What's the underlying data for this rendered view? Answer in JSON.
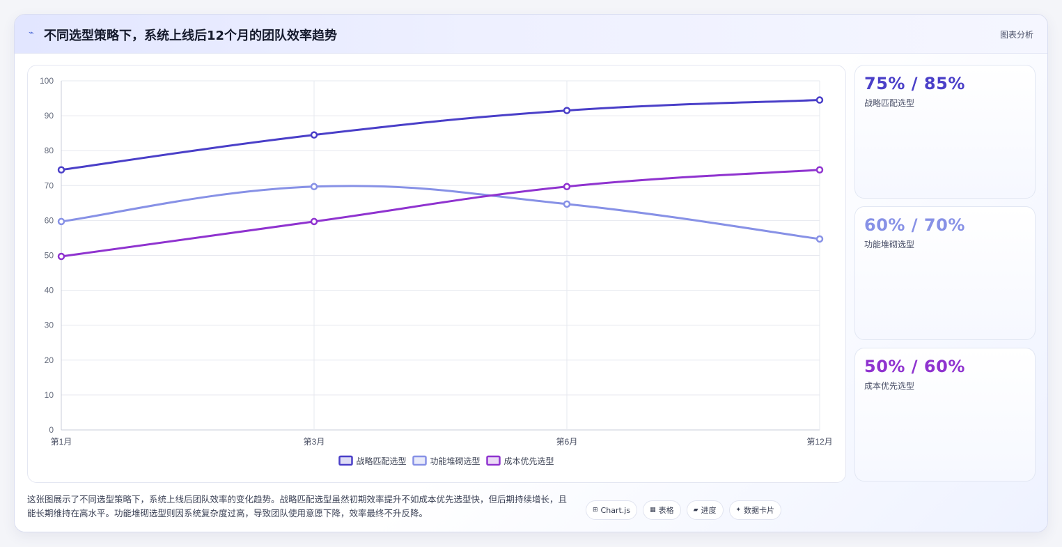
{
  "header": {
    "icon": "sparkline-icon",
    "title": "不同选型策略下，系统上线后12个月的团队效率趋势",
    "tag": "图表分析"
  },
  "colors": {
    "series1": "#4a3fc8",
    "series2": "#8791e6",
    "series3": "#8f33cf"
  },
  "chart_data": {
    "type": "line",
    "categories": [
      "第1月",
      "第3月",
      "第6月",
      "第12月"
    ],
    "ylim": [
      0,
      100
    ],
    "yticks": [
      0,
      10,
      20,
      30,
      40,
      50,
      60,
      70,
      80,
      90,
      100
    ],
    "grid": true,
    "legend_position": "bottom",
    "series": [
      {
        "name": "战略匹配选型",
        "values": [
          74.5,
          84.5,
          91.5,
          94.5
        ],
        "color": "#4a3fc8"
      },
      {
        "name": "功能堆砌选型",
        "values": [
          59.7,
          69.7,
          64.7,
          54.7
        ],
        "color": "#8791e6"
      },
      {
        "name": "成本优先选型",
        "values": [
          49.7,
          59.7,
          69.7,
          74.5
        ],
        "color": "#8f33cf"
      }
    ]
  },
  "stats": [
    {
      "value": "75% / 85%",
      "label": "战略匹配选型",
      "color": "#4a3fc8"
    },
    {
      "value": "60% / 70%",
      "label": "功能堆砌选型",
      "color": "#8791e6"
    },
    {
      "value": "50% / 60%",
      "label": "成本优先选型",
      "color": "#8f33cf"
    }
  ],
  "description": "这张图展示了不同选型策略下，系统上线后团队效率的变化趋势。战略匹配选型虽然初期效率提升不如成本优先选型快，但后期持续增长，且能长期维持在高水平。功能堆砌选型则因系统复杂度过高，导致团队使用意愿下降，效率最终不升反降。",
  "tags": [
    {
      "icon": "⊞",
      "label": "Chart.js"
    },
    {
      "icon": "▦",
      "label": "表格"
    },
    {
      "icon": "▰",
      "label": "进度"
    },
    {
      "icon": "✦",
      "label": "数据卡片"
    }
  ]
}
